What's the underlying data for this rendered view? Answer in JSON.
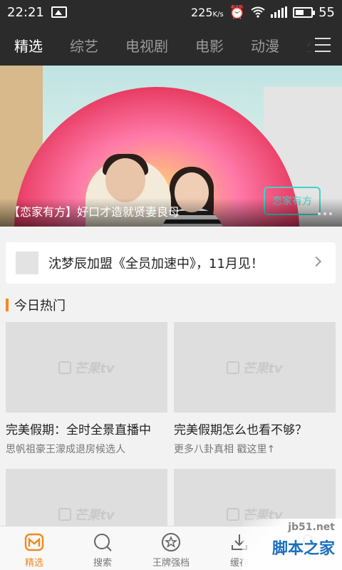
{
  "status": {
    "time": "22:21",
    "speed_value": "225",
    "speed_unit": "K/s",
    "battery_level": "55",
    "battery_fraction": 0.55
  },
  "nav": {
    "tabs": [
      "精选",
      "综艺",
      "电视剧",
      "电影",
      "动漫",
      "少"
    ],
    "active_index": 0
  },
  "banner": {
    "caption": "【恋家有方】好口才造就贤妻良母",
    "overlay_logo": "恋家有方",
    "page_dots": 3
  },
  "notice": {
    "text": "沈梦辰加盟《全员加速中》，11月见！"
  },
  "section": {
    "title": "今日热门"
  },
  "cards": [
    {
      "title": "完美假期：全时全景直播中",
      "subtitle": "思帆祖豪王濛成退房候选人",
      "watermark": "芒果tv"
    },
    {
      "title": "完美假期怎么也看不够？",
      "subtitle": "更多八卦真相 戳这里↑",
      "watermark": "芒果tv"
    },
    {
      "title": "",
      "subtitle": "",
      "watermark": "芒果tv"
    },
    {
      "title": "",
      "subtitle": "",
      "watermark": "芒果tv"
    }
  ],
  "tabbar": {
    "items": [
      {
        "label": "精选",
        "icon": "mango-logo-icon"
      },
      {
        "label": "搜索",
        "icon": "search-icon"
      },
      {
        "label": "王牌强档",
        "icon": "star-icon"
      },
      {
        "label": "缓存",
        "icon": "download-icon"
      },
      {
        "label": "",
        "icon": "user-icon"
      }
    ],
    "active_index": 0
  },
  "watermark_site": {
    "domain": "jb51.net",
    "name": "脚本之家"
  },
  "colors": {
    "accent": "#f28a1e",
    "header_bg": "#2b2b2b",
    "page_bg": "#f2f2f2"
  }
}
